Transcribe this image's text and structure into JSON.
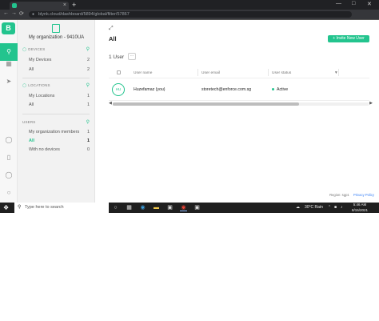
{
  "browser": {
    "tab_close": "×",
    "new_tab": "+",
    "window_controls": [
      "—",
      "□",
      "✕"
    ],
    "nav_icons": [
      "←",
      "→",
      "⟳"
    ],
    "url": "blynk.cloud/dashboard/5894/global/filter/57867"
  },
  "rail": {
    "logo": "B",
    "icons": [
      "search-icon",
      "grid-icon",
      "send-icon",
      "bulb-icon",
      "device-icon",
      "help-icon",
      "user-icon"
    ]
  },
  "sidebar": {
    "org_name": "My organization - 9410UA",
    "devices": {
      "header": "DEVICES",
      "items": [
        {
          "label": "My Devices",
          "count": "2"
        },
        {
          "label": "All",
          "count": "2"
        }
      ]
    },
    "locations": {
      "header": "LOCATIONS",
      "items": [
        {
          "label": "My Locations",
          "count": "1"
        },
        {
          "label": "All",
          "count": "1"
        }
      ]
    },
    "users": {
      "header": "USERS",
      "items": [
        {
          "label": "My organization members",
          "count": "1"
        },
        {
          "label": "All",
          "count": "1"
        },
        {
          "label": "With no devices",
          "count": "0"
        }
      ]
    }
  },
  "main": {
    "title": "All",
    "invite_label": "+ Invite New User",
    "user_count": "1 User",
    "more_label": "···",
    "columns": [
      "User name",
      "User email",
      "User status"
    ],
    "rows": [
      {
        "avatar": "HU",
        "name": "Huzefamaz (you)",
        "email": "storetech@enforce.com.sg",
        "status": "Active"
      }
    ],
    "footer_region": "Region: sgp1",
    "footer_link": "Privacy Policy"
  },
  "taskbar": {
    "search_placeholder": "Type here to search",
    "weather": "30°C  Rain",
    "time": "5:46 AM",
    "date": "8/15/2021"
  },
  "colors": {
    "accent": "#23c48e"
  }
}
